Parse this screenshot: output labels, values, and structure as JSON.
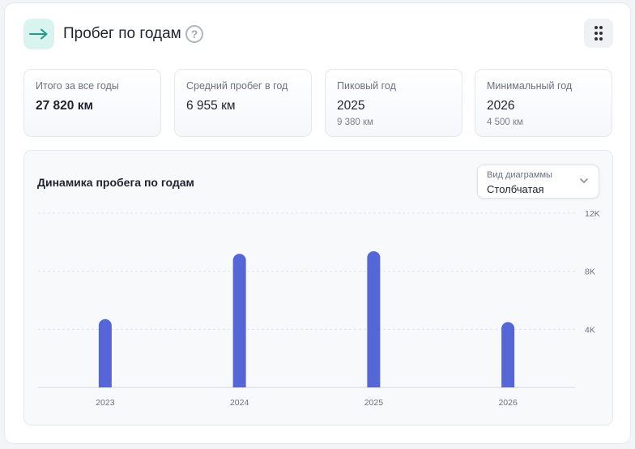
{
  "header": {
    "title": "Пробег по годам",
    "help_label": "?",
    "arrow_icon": "arrow-right-icon",
    "menu_icon": "drag-handle-icon"
  },
  "stats": [
    {
      "label": "Итого за все годы",
      "value": "27 820 км",
      "sub": ""
    },
    {
      "label": "Средний пробег в год",
      "value": "6 955 км",
      "sub": ""
    },
    {
      "label": "Пиковый год",
      "value": "2025",
      "sub": "9 380 км"
    },
    {
      "label": "Минимальный год",
      "value": "2026",
      "sub": "4 500 км"
    }
  ],
  "chart_panel": {
    "title": "Динамика пробега по годам",
    "select": {
      "label": "Вид диаграммы",
      "value": "Столбчатая"
    }
  },
  "colors": {
    "accent": "#5566d6",
    "icon_bg": "#d9f4ef",
    "icon_fg": "#1f9c8a"
  },
  "chart_data": {
    "type": "bar",
    "title": "",
    "xlabel": "",
    "ylabel": "",
    "categories": [
      "2023",
      "2024",
      "2025",
      "2026"
    ],
    "values": [
      4700,
      9200,
      9380,
      4500
    ],
    "ylim": [
      0,
      12000
    ],
    "yticks": [
      4000,
      8000,
      12000
    ],
    "ytick_labels": [
      "4K",
      "8K",
      "12K"
    ],
    "y_axis_side": "right",
    "grid": true,
    "legend": "none"
  }
}
